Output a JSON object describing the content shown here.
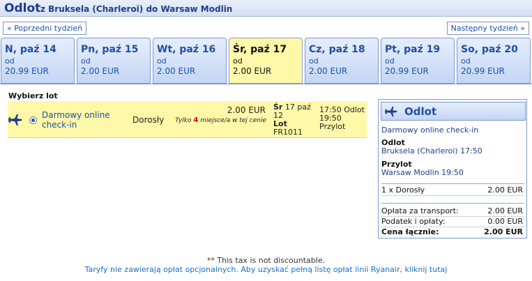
{
  "header": {
    "title": "Odlot",
    "route": "z Bruksela (Charleroi) do Warsaw Modlin"
  },
  "week_nav": {
    "prev_label": "« Poprzedni tydzień",
    "next_label": "Następny tydzień »"
  },
  "days": [
    {
      "label": "N, paź 14",
      "from": "od",
      "price": "20.99 EUR",
      "selected": false
    },
    {
      "label": "Pn, paź 15",
      "from": "od",
      "price": "2.00 EUR",
      "selected": false
    },
    {
      "label": "Wt, paź 16",
      "from": "od",
      "price": "2.00 EUR",
      "selected": false
    },
    {
      "label": "Śr, paź 17",
      "from": "od",
      "price": "2.00 EUR",
      "selected": true
    },
    {
      "label": "Cz, paź 18",
      "from": "od",
      "price": "2.00 EUR",
      "selected": false
    },
    {
      "label": "Pt, paź 19",
      "from": "od",
      "price": "20.99 EUR",
      "selected": false
    },
    {
      "label": "So, paź 20",
      "from": "od",
      "price": "20.99 EUR",
      "selected": false
    }
  ],
  "flight_list": {
    "choose_label": "Wybierz lot",
    "row": {
      "fare_type": "Darmowy online check-in",
      "passenger": "Dorosły",
      "price": "2.00 EUR",
      "availability_prefix": "Tylko",
      "availability_count": "4",
      "availability_suffix": "miejsce/a w tej cenie",
      "date_day": "Śr",
      "date_rest": "17 paź 12",
      "flight_label": "Lot",
      "flight_number": "FR1011",
      "depart_time": "17:50",
      "depart_label": "Odlot",
      "arrive_time": "19:50",
      "arrive_label": "Przylot"
    }
  },
  "summary": {
    "title": "Odlot",
    "fare_type": "Darmowy online check-in",
    "depart_heading": "Odlot",
    "depart_detail": "Bruksela (Charleroi) 17:50",
    "arrive_heading": "Przylot",
    "arrive_detail": "Warsaw Modlin 19:50",
    "passenger_line": "1 x Dorosły",
    "passenger_price": "2.00 EUR",
    "transport_label": "Opłata za transport:",
    "transport_value": "2.00 EUR",
    "tax_label": "Podatek i opłaty:",
    "tax_value": "0.00 EUR",
    "total_label": "Cena łącznie:",
    "total_value": "2.00 EUR"
  },
  "footer": {
    "note": "** This tax is not discountable.",
    "link": "Taryfy nie zawierają opłat opcjonalnych. Aby uzyskać pełną listę opłat linii Ryanair, kliknij tutaj"
  },
  "colors": {
    "accent_blue": "#1e4fa6",
    "selected_yellow": "#fff8a8",
    "tab_blue": "#c4d6f5",
    "availability_red": "#d4000a"
  }
}
